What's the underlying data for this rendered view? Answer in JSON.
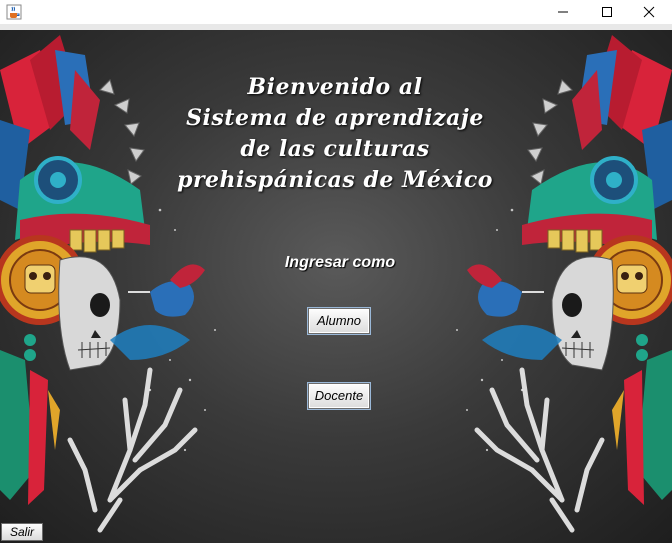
{
  "window": {
    "app_icon": "java-cup-icon",
    "controls": [
      "minimize-icon",
      "maximize-icon",
      "close-icon"
    ]
  },
  "main": {
    "title_lines": [
      "Bienvenido  al",
      "Sistema de aprendizaje",
      "de las culturas",
      "prehispánicas de México"
    ],
    "prompt": "Ingresar como",
    "alumno_label": "Alumno",
    "docente_label": "Docente",
    "salir_label": "Salir"
  },
  "decor": {
    "artwork": "catrina-skeleton-with-hummingbird",
    "colors": {
      "feather_red": "#d8233a",
      "feather_blue": "#2a6fb8",
      "teal": "#1fa58a",
      "gold": "#e0a52a",
      "background_dark": "#2a2a2a"
    }
  }
}
